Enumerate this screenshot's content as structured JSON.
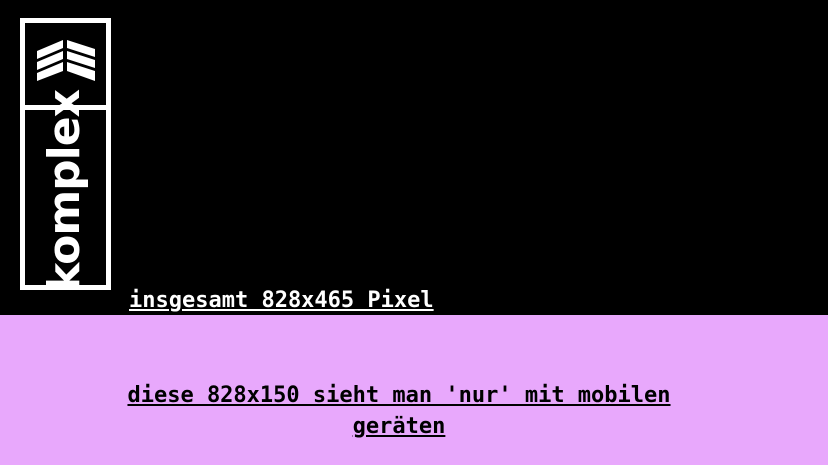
{
  "logo": {
    "wordmark": "komplex",
    "icon": "stacked-planks-icon"
  },
  "banner": {
    "size_caption": "insgesamt 828x465 Pixel"
  },
  "mobile": {
    "caption": "diese 828x150 sieht man 'nur' mit mobilen geräten"
  },
  "colors": {
    "background": "#000000",
    "band": "#e8a8fc",
    "logo": "#ffffff"
  }
}
